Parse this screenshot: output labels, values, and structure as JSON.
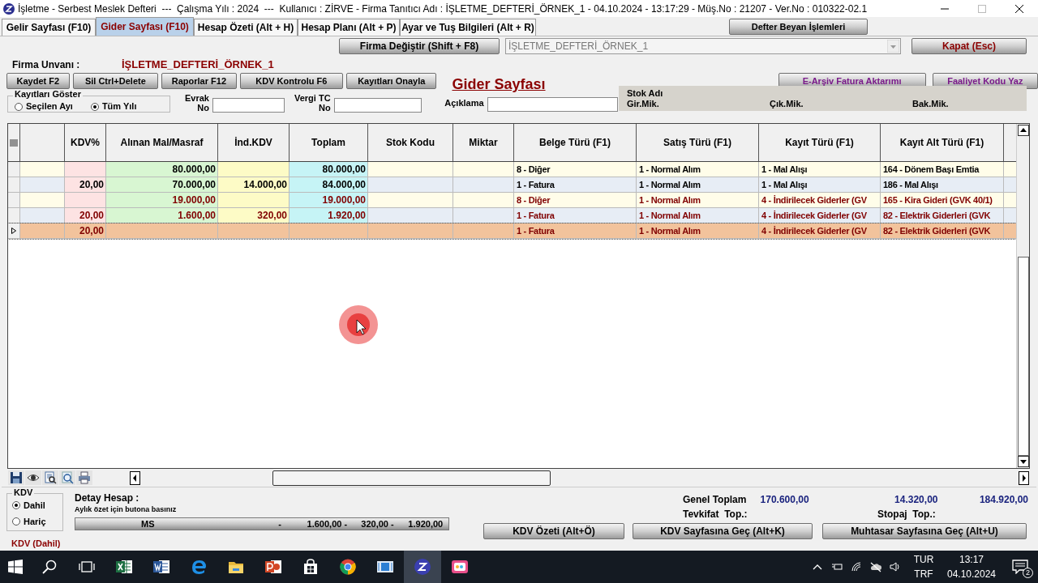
{
  "window": {
    "title": "İşletme - Serbest Meslek Defteri  ---  Çalışma Yılı : 2024  ---  Kullanıcı : ZİRVE - Firma Tanıtıcı Adı : İŞLETME_DEFTERİ_ÖRNEK_1 - 04.10.2024 - 13:17:29 - Müş.No : 21207 - Ver.No : 010322-02.1"
  },
  "tabs": [
    {
      "label": "Gelir Sayfası (F10)",
      "selected": false
    },
    {
      "label": "Gider Sayfası (F10)",
      "selected": true
    },
    {
      "label": "Hesap Özeti (Alt + H)",
      "selected": false
    },
    {
      "label": "Hesap Planı (Alt + P)",
      "selected": false
    },
    {
      "label": "Ayar ve Tuş Bilgileri (Alt + R)",
      "selected": false
    }
  ],
  "defter_beyan_button": "Defter Beyan İşlemleri",
  "firma_degistir_button": "Firma Değiştir (Shift + F8)",
  "firma_select": {
    "value": "İŞLETME_DEFTERİ_ÖRNEK_1",
    "disabled": true
  },
  "close_button": "Kapat (Esc)",
  "firma_unvani": {
    "label": "Firma Unvanı :",
    "value": "İŞLETME_DEFTERİ_ÖRNEK_1"
  },
  "action_buttons": [
    "Kaydet F2",
    "Sil Ctrl+Delete",
    "Raporlar F12",
    "KDV Kontrolu F6",
    "Kayıtları Onayla"
  ],
  "page_heading": "Gider Sayfası",
  "right_buttons": [
    "E-Arşiv Fatura Aktarımı",
    "Faaliyet Kodu Yaz"
  ],
  "show_records": {
    "title": "Kayıtları Göster",
    "options": [
      {
        "label": "Seçilen Ayı",
        "selected": false
      },
      {
        "label": "Tüm Yılı",
        "selected": true
      }
    ]
  },
  "fields": [
    {
      "label_lines": [
        "Evrak",
        "No"
      ]
    },
    {
      "label_lines": [
        "Vergi TC",
        "No"
      ]
    },
    {
      "label_lines": [
        "Açıklama"
      ]
    }
  ],
  "stock_panel": {
    "title": "Stok Adı",
    "labels": [
      "Gir.Mik.",
      "Çık.Mik.",
      "Bak.Mik."
    ]
  },
  "table": {
    "columns": [
      "KDV%",
      "Alınan Mal/Masraf",
      "İnd.KDV",
      "Toplam",
      "Stok Kodu",
      "Miktar",
      "Belge Türü (F1)",
      "Satış Türü (F1)",
      "Kayıt Türü (F1)",
      "Kayıt Alt Türü (F1)"
    ],
    "rows": [
      {
        "selected": false,
        "color": "#000000",
        "alinan": "80.000,00",
        "toplam": "80.000,00",
        "belge_turu": "8 - Diğer",
        "satis_turu": "1 - Normal Alım",
        "kayit_turu": "1 - Mal Alışı",
        "kayit_alt_turu": "164 - Dönem Başı Emtia"
      },
      {
        "selected": false,
        "color": "#000000",
        "kdv_rate": "20,00",
        "alinan": "70.000,00",
        "ind_kdv": "14.000,00",
        "toplam": "84.000,00",
        "belge_turu": "1 - Fatura",
        "satis_turu": "1 - Normal Alım",
        "kayit_turu": "1 - Mal Alışı",
        "kayit_alt_turu": "186 - Mal Alışı"
      },
      {
        "selected": false,
        "color": "#800000",
        "alinan": "19.000,00",
        "toplam": "19.000,00",
        "belge_turu": "8 - Diğer",
        "satis_turu": "1 - Normal Alım",
        "kayit_turu": "4 - İndirilecek Giderler (GV",
        "kayit_alt_turu": "165 - Kira Gideri (GVK 40/1)"
      },
      {
        "selected": false,
        "color": "#800000",
        "kdv_rate": "20,00",
        "alinan": "1.600,00",
        "ind_kdv": "320,00",
        "toplam": "1.920,00",
        "belge_turu": "1 - Fatura",
        "satis_turu": "1 - Normal Alım",
        "kayit_turu": "4 - İndirilecek Giderler (GV",
        "kayit_alt_turu": "82 - Elektrik Giderleri (GVK"
      },
      {
        "selected": true,
        "color": "#800000",
        "kdv_rate": "20,00",
        "belge_turu": "1 - Fatura",
        "satis_turu": "1 - Normal Alım",
        "kayit_turu": "4 - İndirilecek Giderler (GV",
        "kayit_alt_turu": "82 - Elektrik Giderleri (GVK"
      }
    ]
  },
  "kdv_group": {
    "title": "KDV",
    "options": [
      {
        "label": "Dahil",
        "selected": true
      },
      {
        "label": "Hariç",
        "selected": false
      }
    ],
    "status": "KDV (Dahil)"
  },
  "detail": {
    "title": "Detay Hesap :",
    "hint": "Aylık özet için butona basınız",
    "bar_parts": [
      "MS",
      "-",
      "1.600,00 -",
      "320,00 -",
      "1.920,00"
    ]
  },
  "totals": {
    "genel_label": "Genel Toplam",
    "genel_values": [
      "170.600,00",
      "14.320,00",
      "184.920,00"
    ],
    "tevkifat_label": "Tevkifat  Top.:",
    "stopaj_label": "Stopaj  Top.:"
  },
  "bottom_buttons": [
    "KDV Özeti (Alt+Ö)",
    "KDV Sayfasına Geç (Alt+K)",
    "Muhtasar Sayfasına Geç (Alt+U)"
  ],
  "taskbar": {
    "apps": [
      {
        "kind": "excel",
        "active": false
      },
      {
        "kind": "word",
        "active": false
      },
      {
        "kind": "edge",
        "active": false
      },
      {
        "kind": "folder",
        "active": false
      },
      {
        "kind": "powerpoint",
        "active": false
      },
      {
        "kind": "store",
        "active": false
      },
      {
        "kind": "chrome",
        "active": false
      },
      {
        "kind": "window",
        "active": false
      },
      {
        "kind": "zirve",
        "active": true
      },
      {
        "kind": "recorder",
        "active": false
      }
    ],
    "lang": [
      "TUR",
      "TRF"
    ],
    "time": "13:17",
    "date": "04.10.2024",
    "notifications": "2"
  }
}
